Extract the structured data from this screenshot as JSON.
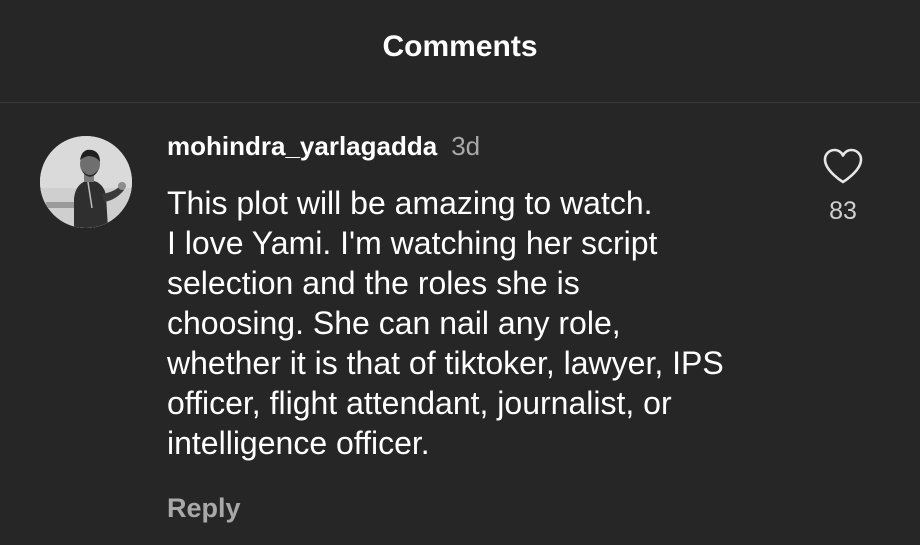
{
  "header": {
    "title": "Comments"
  },
  "comment": {
    "avatar_icon": "user-avatar-icon",
    "username": "mohindra_yarlagadda",
    "time_ago": "3d",
    "text": "This plot will be amazing to watch.\nI love Yami. I'm watching her script\nselection and the roles she is\nchoosing. She can nail any role,\nwhether it is that of tiktoker, lawyer, IPS\nofficer, flight attendant, journalist, or\nintelligence officer.",
    "like_icon": "heart-icon",
    "like_count": "83",
    "reply_label": "Reply"
  },
  "colors": {
    "background": "#262626",
    "primary_text": "#ffffff",
    "secondary_text": "#a8a8a8",
    "divider": "#3a3a3a"
  }
}
